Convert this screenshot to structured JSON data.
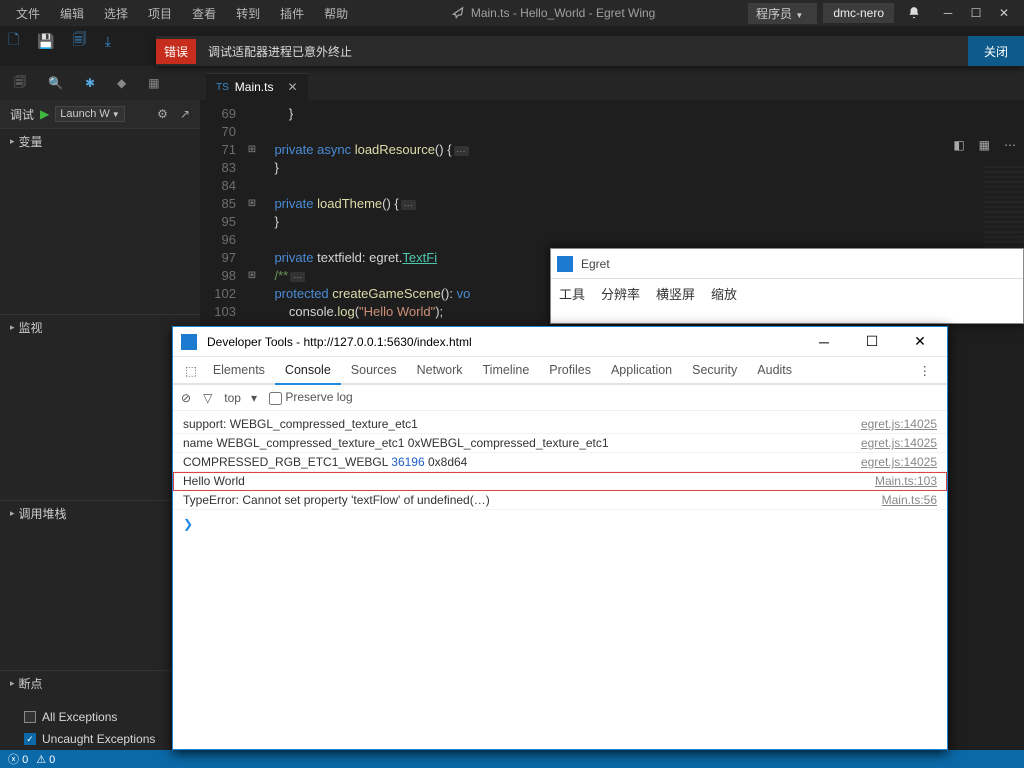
{
  "menu": [
    "文件",
    "编辑",
    "选择",
    "项目",
    "查看",
    "转到",
    "插件",
    "帮助"
  ],
  "title": "Main.ts - Hello_World - Egret Wing",
  "programmer_label": "程序员",
  "user": "dmc-nero",
  "banner": {
    "tag": "错误",
    "message": "调试适配器进程已意外终止",
    "close": "关闭"
  },
  "debug": {
    "label": "调试",
    "select": "Launch W",
    "gear": "⚙"
  },
  "sections": {
    "vars": "变量",
    "watch": "监视",
    "callstack": "调用堆栈",
    "breakpoints": "断点"
  },
  "bp": {
    "all": "All Exceptions",
    "uncaught": "Uncaught Exceptions"
  },
  "status": {
    "errors": "0",
    "warn": "0"
  },
  "tab": {
    "name": "Main.ts"
  },
  "code": [
    {
      "ln": "69",
      "plus": "",
      "html": "        <span class='id'>}</span>"
    },
    {
      "ln": "70",
      "plus": "",
      "html": ""
    },
    {
      "ln": "71",
      "plus": "⊞",
      "html": "    <span class='kw'>private</span> <span class='kw'>async</span> <span class='fn'>loadResource</span><span class='id'>() {</span><span class='dots'>⋯</span>"
    },
    {
      "ln": "83",
      "plus": "",
      "html": "    <span class='id'>}</span>"
    },
    {
      "ln": "84",
      "plus": "",
      "html": ""
    },
    {
      "ln": "85",
      "plus": "⊞",
      "html": "    <span class='kw'>private</span> <span class='fn'>loadTheme</span><span class='id'>() {</span><span class='dots'>⋯</span>"
    },
    {
      "ln": "95",
      "plus": "",
      "html": "    <span class='id'>}</span>"
    },
    {
      "ln": "96",
      "plus": "",
      "html": ""
    },
    {
      "ln": "97",
      "plus": "",
      "html": "    <span class='kw'>private</span> <span class='id'>textfield:</span> <span class='id'>egret.</span><span class='cls'>TextFi</span>"
    },
    {
      "ln": "98",
      "plus": "⊞",
      "html": "    <span class='cm'>/**</span><span class='dots'>⋯</span>"
    },
    {
      "ln": "102",
      "plus": "",
      "html": "    <span class='kw'>protected</span> <span class='fn'>createGameScene</span><span class='id'>():</span> <span class='kw'>vo</span>"
    },
    {
      "ln": "103",
      "plus": "",
      "html": "        <span class='id'>console.</span><span class='fn'>log</span><span class='id'>(</span><span class='st'>\"Hello World\"</span><span class='id'>);</span>"
    }
  ],
  "egret": {
    "title": "Egret",
    "menu": [
      "工具",
      "分辨率",
      "横竖屏",
      "缩放"
    ]
  },
  "devtools": {
    "title": "Developer Tools - http://127.0.0.1:5630/index.html",
    "tabs": [
      "Elements",
      "Console",
      "Sources",
      "Network",
      "Timeline",
      "Profiles",
      "Application",
      "Security",
      "Audits"
    ],
    "active_tab": "Console",
    "filter": {
      "top": "top",
      "preserve": "Preserve log"
    },
    "logs": [
      {
        "msg": "support: WEBGL_compressed_texture_etc1",
        "src": "egret.js:14025"
      },
      {
        "msg": "name WEBGL_compressed_texture_etc1 0xWEBGL_compressed_texture_etc1",
        "src": "egret.js:14025"
      },
      {
        "msg": "COMPRESSED_RGB_ETC1_WEBGL <span class='numc'>36196</span> 0x8d64",
        "src": "egret.js:14025"
      },
      {
        "msg": "Hello World",
        "src": "Main.ts:103",
        "hello": true
      },
      {
        "msg": "TypeError: Cannot set property 'textFlow' of undefined(…)",
        "src": "Main.ts:56"
      }
    ]
  }
}
